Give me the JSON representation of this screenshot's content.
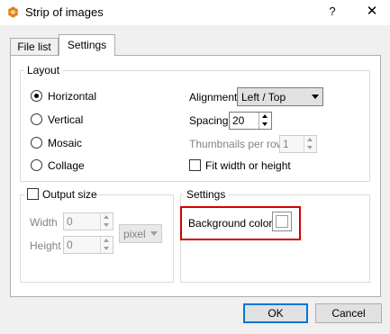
{
  "window": {
    "title": "Strip of images",
    "help_label": "?",
    "close_label": "✕"
  },
  "tabs": [
    {
      "label": "File list",
      "active": false
    },
    {
      "label": "Settings",
      "active": true
    }
  ],
  "layout": {
    "group_label": "Layout",
    "options": [
      "Horizontal",
      "Vertical",
      "Mosaic",
      "Collage"
    ],
    "selected": "Horizontal",
    "alignment_label": "Alignment",
    "alignment_value": "Left / Top",
    "spacing_label": "Spacing",
    "spacing_value": "20",
    "thumbs_per_row_label": "Thumbnails per row",
    "thumbs_per_row_value": "1",
    "fit_label": "Fit width or height"
  },
  "output_size": {
    "label": "Output size",
    "width_label": "Width",
    "width_value": "0",
    "height_label": "Height",
    "height_value": "0",
    "unit_value": "pixel"
  },
  "settings": {
    "group_label": "Settings",
    "bg_color_label": "Background color",
    "bg_color": "#ffffff",
    "highlight_color": "#d40000"
  },
  "buttons": {
    "ok": "OK",
    "cancel": "Cancel"
  }
}
